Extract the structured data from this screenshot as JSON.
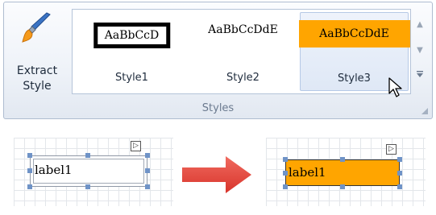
{
  "ribbon": {
    "extract_button": {
      "label": "Extract\nStyle",
      "icon": "brush-icon"
    },
    "styles_gallery": [
      {
        "preview": "AaBbCcD",
        "name": "Style1"
      },
      {
        "preview": "AaBbCcDdE",
        "name": "Style2"
      },
      {
        "preview": "AaBbCcDdE",
        "name": "Style3",
        "selected": true,
        "fill": "#FFA500"
      }
    ],
    "group_label": "Styles"
  },
  "before": {
    "label_text": "label1"
  },
  "after": {
    "label_text": "label1",
    "fill": "#FFA500"
  },
  "arrow": {
    "color": "#E8413A",
    "icon": "right-arrow-icon"
  },
  "smart_tag_glyph": "▷"
}
